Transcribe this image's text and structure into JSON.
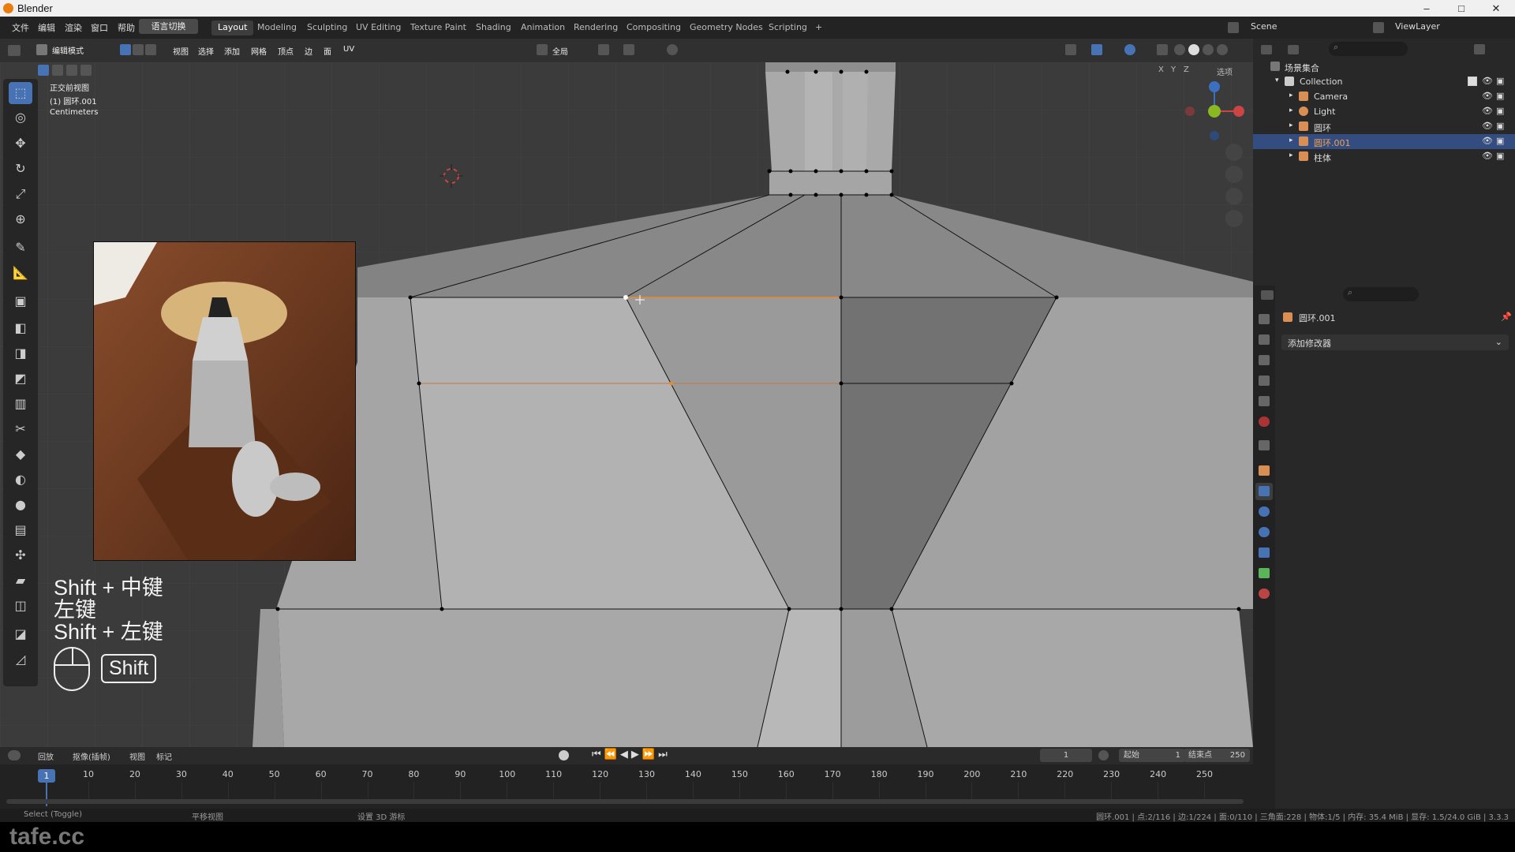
{
  "title": {
    "app": "Blender"
  },
  "menu": {
    "file": "文件",
    "edit": "编辑",
    "render": "渲染",
    "window": "窗口",
    "help": "帮助",
    "lang": "语言切换"
  },
  "workspaces": [
    "Layout",
    "Modeling",
    "Sculpting",
    "UV Editing",
    "Texture Paint",
    "Shading",
    "Animation",
    "Rendering",
    "Compositing",
    "Geometry Nodes",
    "Scripting",
    "+"
  ],
  "scene": {
    "label": "Scene",
    "viewlayer": "ViewLayer"
  },
  "header3d": {
    "mode": "编辑模式",
    "view": "视图",
    "select": "选择",
    "add": "添加",
    "mesh": "网格",
    "vertex": "顶点",
    "edge": "边",
    "face": "面",
    "uv": "UV",
    "global": "全局",
    "options": "选项",
    "x": "X",
    "y": "Y",
    "z": "Z"
  },
  "viewport": {
    "view_name": "正交前视图",
    "object": "(1) 圆环.001",
    "units": "Centimeters"
  },
  "keys": {
    "line1": "Shift + 中键",
    "line2": "左键",
    "line3": "Shift + 左键",
    "shift": "Shift"
  },
  "outliner": {
    "scene_collection": "场景集合",
    "collection": "Collection",
    "items": [
      {
        "name": "Camera",
        "icon": "camera-icon"
      },
      {
        "name": "Light",
        "icon": "light-icon"
      },
      {
        "name": "圆环",
        "icon": "mesh-icon"
      },
      {
        "name": "圆环.001",
        "icon": "mesh-icon",
        "selected": true
      },
      {
        "name": "柱体",
        "icon": "mesh-icon"
      }
    ]
  },
  "properties": {
    "object_name": "圆环.001",
    "add_modifier": "添加修改器"
  },
  "timeline": {
    "playback": "回放",
    "keying": "抠像(插帧)",
    "view": "视图",
    "marker": "标记",
    "current": "1",
    "start_label": "起始",
    "start": "1",
    "end_label": "结束点",
    "end": "250",
    "ticks": [
      "1",
      "10",
      "20",
      "30",
      "40",
      "50",
      "60",
      "70",
      "80",
      "90",
      "100",
      "110",
      "120",
      "130",
      "140",
      "150",
      "160",
      "170",
      "180",
      "190",
      "200",
      "210",
      "220",
      "230",
      "240",
      "250"
    ]
  },
  "status": {
    "left": "Select (Toggle)",
    "mid": "平移视图",
    "mid2": "设置 3D 游标",
    "right": "圆环.001 | 点:2/116 | 边:1/224 | 面:0/110 | 三角面:228 | 物体:1/5 | 内存: 35.4 MiB | 显存: 1.5/24.0 GiB | 3.3.3"
  },
  "watermark": "tafe.cc"
}
